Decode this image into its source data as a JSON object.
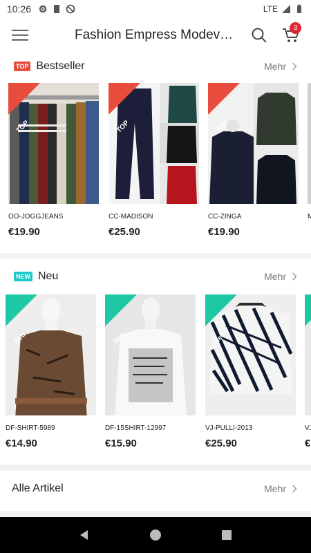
{
  "status": {
    "time": "10:26",
    "network": "LTE"
  },
  "header": {
    "title": "Fashion Empress Modever…",
    "cart_count": "3"
  },
  "sections": [
    {
      "badge": "TOP",
      "badge_color": "#e74c3c",
      "title": "Bestseller",
      "more": "Mehr",
      "products": [
        {
          "name": "OO-JOGGJEANS",
          "price": "€19.90",
          "ribbon": "TOP"
        },
        {
          "name": "CC-MADISON",
          "price": "€25.90",
          "ribbon": "TOP"
        },
        {
          "name": "CC-ZINGA",
          "price": "€19.90",
          "ribbon": "TOP"
        },
        {
          "name": "M",
          "price": ""
        }
      ]
    },
    {
      "badge": "NEW",
      "badge_color": "#1ec8c8",
      "title": "Neu",
      "more": "Mehr",
      "products": [
        {
          "name": "DF-SHIRT-5989",
          "price": "€14.90",
          "ribbon": "Neu"
        },
        {
          "name": "DF-15SHIRT-12997",
          "price": "€15.90",
          "ribbon": "Neu"
        },
        {
          "name": "VJ-PULLI-2013",
          "price": "€25.90",
          "ribbon": "Neu"
        },
        {
          "name": "VJ",
          "price": "€"
        }
      ]
    },
    {
      "title": "Alle Artikel",
      "more": "Mehr"
    }
  ]
}
